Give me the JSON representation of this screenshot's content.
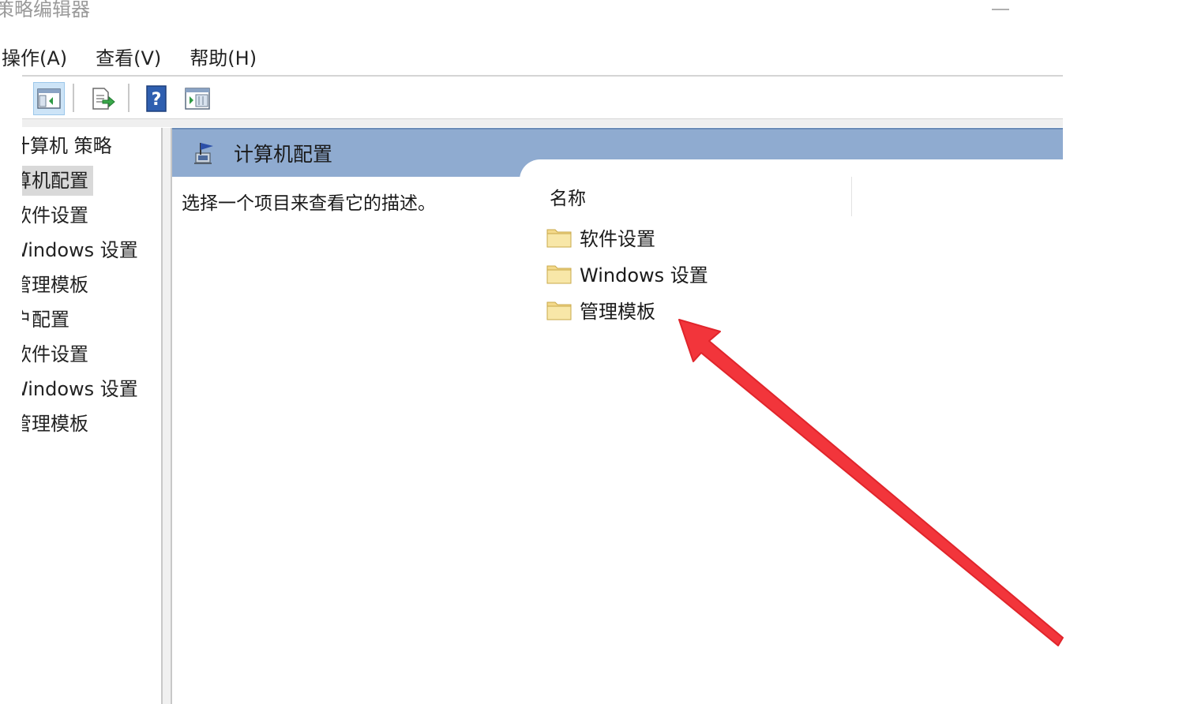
{
  "window": {
    "title": "组策略编辑器"
  },
  "menu": [
    {
      "label": "操作(A)"
    },
    {
      "label": "查看(V)"
    },
    {
      "label": "帮助(H)"
    }
  ],
  "toolbar": {
    "icons": [
      "console-tree-icon",
      "export-list-icon",
      "help-icon",
      "extended-view-icon"
    ]
  },
  "tree": [
    {
      "label": "本地计算机 策略"
    },
    {
      "label": "计算机配置"
    },
    {
      "label": "软件设置"
    },
    {
      "label": "Windows 设置"
    },
    {
      "label": "管理模板"
    },
    {
      "label": "用户配置"
    },
    {
      "label": "软件设置"
    },
    {
      "label": "Windows 设置"
    },
    {
      "label": "管理模板"
    }
  ],
  "content": {
    "header_title": "计算机配置",
    "description": "选择一个项目来查看它的描述。",
    "column_name": "名称",
    "items": [
      {
        "label": "软件设置"
      },
      {
        "label": "Windows 设置"
      },
      {
        "label": "管理模板"
      }
    ]
  },
  "colors": {
    "header_band": "#8fabd0",
    "annotation_arrow": "#f2353b",
    "selected_tree_bg": "#d9d9d9"
  }
}
